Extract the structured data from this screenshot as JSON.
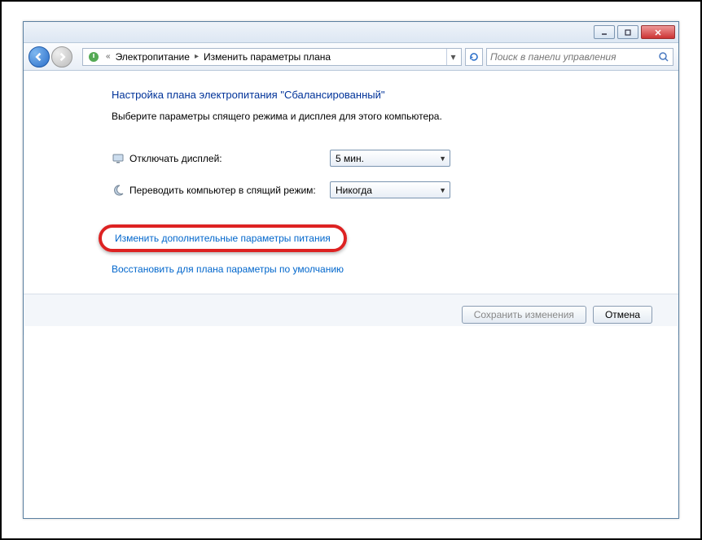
{
  "breadcrumb": {
    "item1": "Электропитание",
    "item2": "Изменить параметры плана"
  },
  "search": {
    "placeholder": "Поиск в панели управления"
  },
  "heading": "Настройка плана электропитания \"Сбалансированный\"",
  "subtitle": "Выберите параметры спящего режима и дисплея для этого компьютера.",
  "rows": {
    "display": {
      "label": "Отключать дисплей:",
      "value": "5 мин."
    },
    "sleep": {
      "label": "Переводить компьютер в спящий режим:",
      "value": "Никогда"
    }
  },
  "links": {
    "advanced": "Изменить дополнительные параметры питания",
    "restore": "Восстановить для плана параметры по умолчанию"
  },
  "buttons": {
    "save": "Сохранить изменения",
    "cancel": "Отмена"
  }
}
